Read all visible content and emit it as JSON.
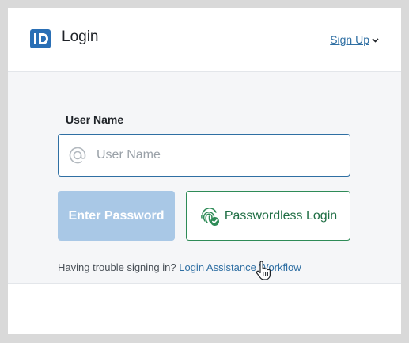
{
  "header": {
    "logo_icon": "id-badge-icon",
    "title": "Login",
    "signup_label": "Sign Up"
  },
  "form": {
    "username_label": "User Name",
    "username_placeholder": "User Name",
    "username_value": "",
    "username_icon": "at-icon"
  },
  "buttons": {
    "enter_password": "Enter Password",
    "passwordless": "Passwordless Login",
    "passwordless_icon": "fingerprint-check-icon"
  },
  "help": {
    "prompt": "Having trouble signing in?",
    "link": "Login Assistance Workflow"
  },
  "colors": {
    "brand": "#2f6fa3",
    "accent_green": "#2e8b57",
    "disabled_button": "#a9c8e6",
    "page_background": "#f5f6f8"
  }
}
